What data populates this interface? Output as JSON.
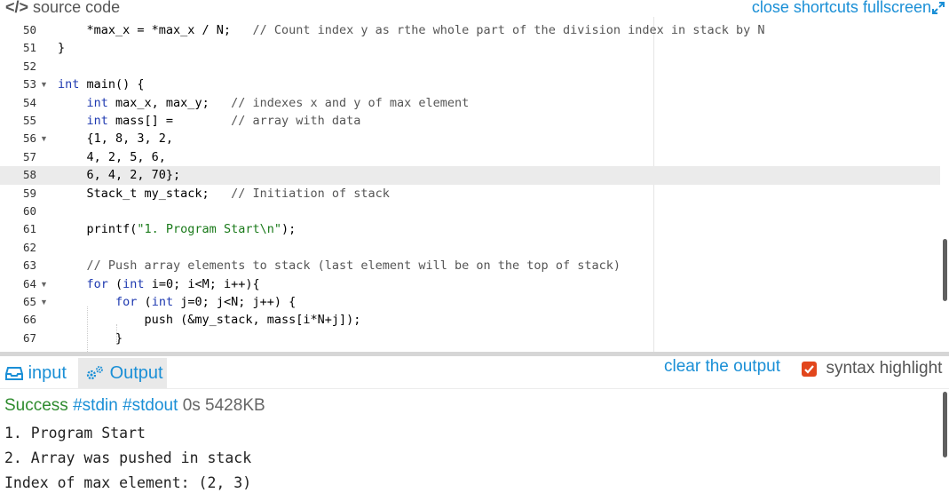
{
  "header": {
    "glyph": "</>",
    "title": "source code",
    "actions": [
      "close",
      "shortcuts",
      "fullscreen"
    ],
    "fullscreen_icon": "expand-icon"
  },
  "editor": {
    "active_line": 58,
    "lines": [
      {
        "n": "50",
        "fold": false
      },
      {
        "n": "51",
        "fold": false
      },
      {
        "n": "52",
        "fold": false
      },
      {
        "n": "53",
        "fold": true
      },
      {
        "n": "54",
        "fold": false
      },
      {
        "n": "55",
        "fold": false
      },
      {
        "n": "56",
        "fold": true
      },
      {
        "n": "57",
        "fold": false
      },
      {
        "n": "58",
        "fold": false
      },
      {
        "n": "59",
        "fold": false
      },
      {
        "n": "60",
        "fold": false
      },
      {
        "n": "61",
        "fold": false
      },
      {
        "n": "62",
        "fold": false
      },
      {
        "n": "63",
        "fold": false
      },
      {
        "n": "64",
        "fold": true
      },
      {
        "n": "65",
        "fold": true
      },
      {
        "n": "66",
        "fold": false
      },
      {
        "n": "67",
        "fold": false
      }
    ],
    "code": {
      "l50_a": "    *max_x = *max_x / N;   ",
      "l50_c": "// Count index y as rthe whole part of the division index in stack by N",
      "l51": "}",
      "l53_kw": "int",
      "l53_rest": " main() {",
      "l54_kw": "int",
      "l54_rest": " max_x, max_y;   ",
      "l54_c": "// indexes x and y of max element",
      "l55_kw": "int",
      "l55_rest": " mass[] =        ",
      "l55_c": "// array with data",
      "l56": "    {1, 8, 3, 2,",
      "l57": "    4, 2, 5, 6,",
      "l58": "    6, 4, 2, 70};",
      "l59_a": "    Stack_t my_stack;   ",
      "l59_c": "// Initiation of stack",
      "l61_a": "    printf(",
      "l61_s": "\"1. Program Start\\n\"",
      "l61_b": ");",
      "l63_c": "// Push array elements to stack (last element will be on the top of stack)",
      "l64_kw1": "for",
      "l64_a": " (",
      "l64_kw2": "int",
      "l64_b": " i=0; i<M; i++){",
      "l65_kw1": "for",
      "l65_a": " (",
      "l65_kw2": "int",
      "l65_b": " j=0; j<N; j++) {",
      "l66": "            push (&my_stack, mass[i*N+j]);",
      "l67": "        }"
    }
  },
  "tabs": {
    "input_label": "input",
    "input_icon": "inbox-icon",
    "output_label": "Output",
    "output_icon": "gears-icon"
  },
  "controls": {
    "clear_label": "clear the output",
    "syntax_label": "syntax highlight",
    "syntax_checked": true,
    "checkbox_color": "#e2461c"
  },
  "status": {
    "result": "Success",
    "stdin": "#stdin",
    "stdout": "#stdout",
    "time": "0s",
    "memory": "5428KB"
  },
  "output_lines": [
    "1. Program Start",
    "2. Array was pushed in stack",
    "Index of max element: (2, 3)"
  ],
  "colors": {
    "link": "#1a8fd6",
    "success": "#2e8b2e",
    "keyword": "#1e39b0"
  }
}
